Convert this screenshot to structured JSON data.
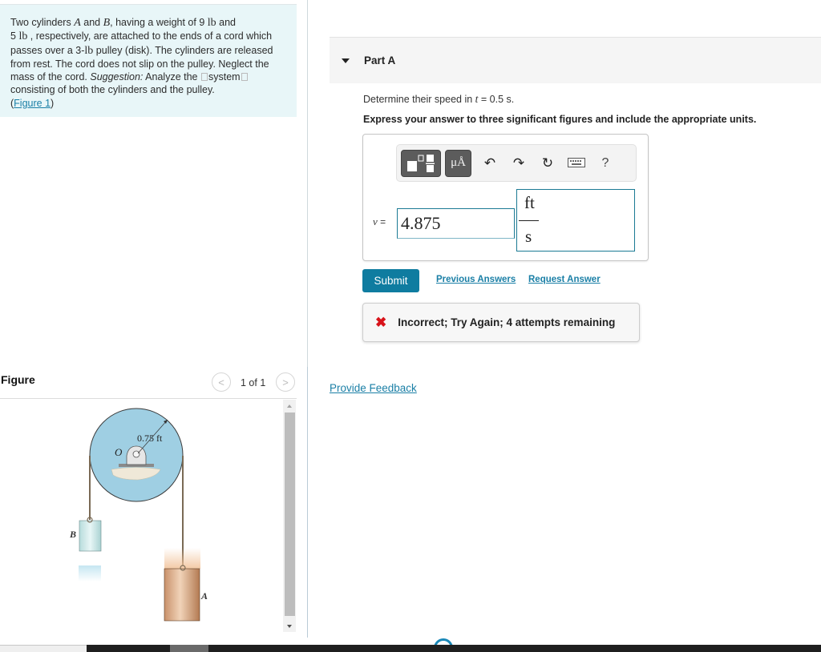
{
  "problem": {
    "text_segments": {
      "s1": "Two cylinders ",
      "var_a": "A",
      "s2": " and ",
      "var_b": "B",
      "s3": ", having a weight of 9 ",
      "unit_lb1": "lb",
      "s4": " and ",
      "s5": "5 ",
      "unit_lb2": "lb",
      "s6": " , respectively, are attached to the ends of a cord which passes over a 3-",
      "unit_lb3": "lb",
      "s7": " pulley (disk). The cylinders are released from rest. The cord does not slip on the pulley. Neglect the mass of the cord. ",
      "suggestion_label": "Suggestion:",
      "s8": " Analyze the ",
      "system_word": "system",
      "s9": " consisting of both the cylinders and the pulley.",
      "paren_open": "(",
      "figure_link": "Figure 1",
      "paren_close": ")"
    }
  },
  "part": {
    "title": "Part A",
    "question_prefix": "Determine their speed in ",
    "question_var": "t",
    "question_suffix": " = 0.5 s.",
    "instruction": "Express your answer to three significant figures and include the appropriate units."
  },
  "answer": {
    "toolbar": {
      "templates_icon": "templates-icon",
      "units_label": "μÅ",
      "undo": "↶",
      "redo": "↷",
      "reset": "↻",
      "keyboard": "keyboard-icon",
      "help": "?"
    },
    "variable": "v",
    "equals": "=",
    "value": "4.875",
    "unit_numerator": "ft",
    "unit_denominator": "s"
  },
  "actions": {
    "submit": "Submit",
    "previous_answers": "Previous Answers",
    "request_answer": "Request Answer"
  },
  "feedback": {
    "icon": "✖",
    "message": "Incorrect; Try Again; 4 attempts remaining",
    "status_color": "#d8131a"
  },
  "provide_feedback": "Provide Feedback",
  "figure": {
    "title": "Figure",
    "prev": "<",
    "next": ">",
    "page": "1 of 1",
    "labels": {
      "radius": "0.75 ft",
      "center": "O",
      "cyl_b": "B",
      "cyl_a": "A"
    }
  }
}
